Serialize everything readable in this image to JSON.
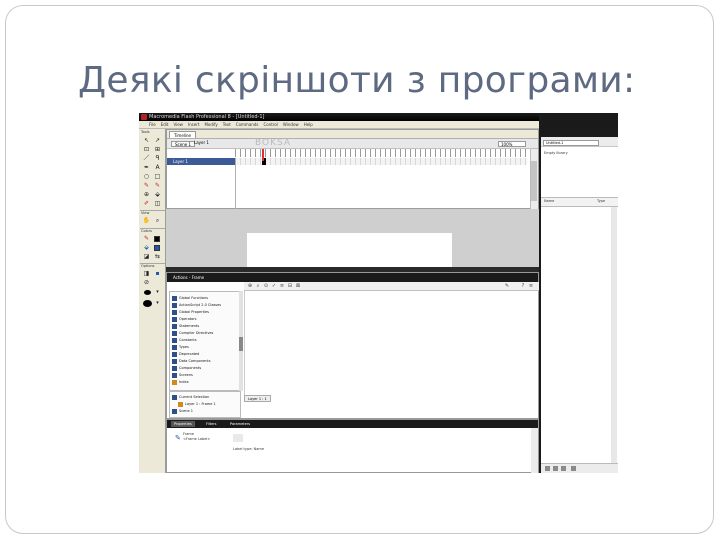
{
  "slide": {
    "title": "Деякі скріншоти з програми:"
  },
  "app": {
    "window_title": "Macromedia Flash Professional 8 - [Untitled-1]",
    "menu": [
      "File",
      "Edit",
      "View",
      "Insert",
      "Modify",
      "Text",
      "Commands",
      "Control",
      "Window",
      "Help"
    ],
    "tools_labels": [
      "Tools",
      "View",
      "Colors",
      "Options"
    ],
    "timeline": {
      "tab_label": "Timeline",
      "scene_label": "Scene 1",
      "layer_header": "Layer 1",
      "layer_name": "Layer 1",
      "watermark": "BOKSA",
      "zoom": "100%",
      "fps_status": "1  12.0 fps  0.0s"
    },
    "actions": {
      "header": "Actions - Frame",
      "categories": [
        "Global Functions",
        "ActionScript 2.0 Classes",
        "Global Properties",
        "Operators",
        "Statements",
        "Compiler Directives",
        "Constants",
        "Types",
        "Deprecated",
        "Data Components",
        "Components",
        "Screens",
        "Index"
      ],
      "script_nav_items": [
        "Current Selection",
        "Layer 1 : Frame 1",
        "Scene 1"
      ],
      "script_tab": "Layer 1 : 1"
    },
    "properties": {
      "tabs": [
        "Properties",
        "Filters",
        "Parameters"
      ],
      "label_line1": "Frame",
      "label_line2": "<Frame Label>",
      "field": "Label type: Name"
    },
    "right_panel": {
      "select_value": "Untitled-1",
      "empty_text": "Empty library",
      "col_name": "Name",
      "col_type": "Type"
    }
  }
}
